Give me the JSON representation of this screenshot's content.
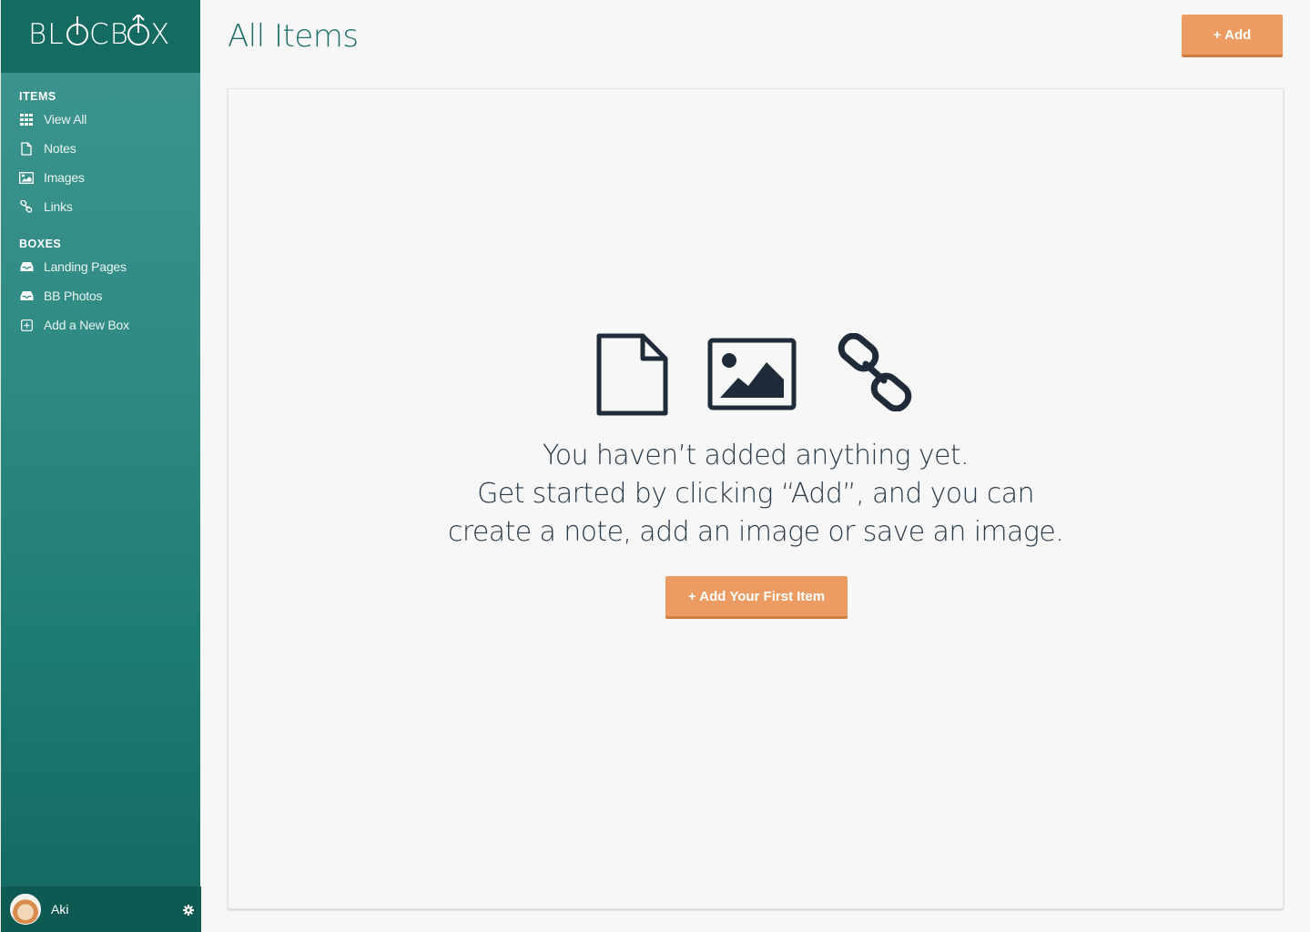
{
  "app": {
    "logo_text": "BL CB X",
    "logo_full": "BLOCBOX"
  },
  "header": {
    "title": "All Items",
    "add_label": "+ Add"
  },
  "sidebar": {
    "items_title": "ITEMS",
    "items": [
      {
        "label": "View All",
        "icon": "grid-icon"
      },
      {
        "label": "Notes",
        "icon": "note-icon"
      },
      {
        "label": "Images",
        "icon": "image-icon"
      },
      {
        "label": "Links",
        "icon": "link-icon"
      }
    ],
    "boxes_title": "BOXES",
    "boxes": [
      {
        "label": "Landing Pages",
        "icon": "inbox-icon"
      },
      {
        "label": "BB Photos",
        "icon": "inbox-icon"
      },
      {
        "label": "Add a New Box",
        "icon": "plus-square-icon"
      }
    ]
  },
  "user": {
    "name": "Aki"
  },
  "empty_state": {
    "line1": "You haven’t added anything yet.",
    "line2": "Get started by clicking “Add”, and you can",
    "line3": "create a note, add an image or save an image.",
    "button_label": "+ Add Your First Item"
  },
  "colors": {
    "accent": "#ec9c62",
    "sidebar_top": "#3f9590",
    "sidebar_bottom": "#136660",
    "title": "#1e6f69",
    "icon_dark": "#1f2b38"
  }
}
